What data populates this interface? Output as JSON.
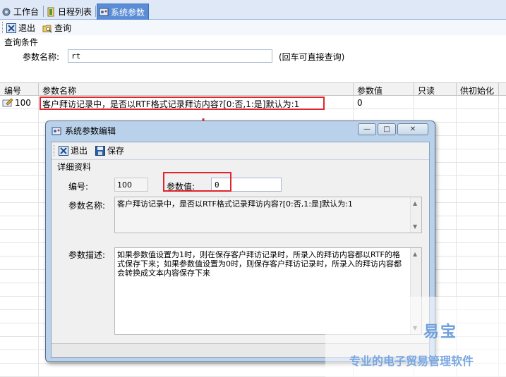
{
  "tabs": [
    {
      "label": "工作台",
      "icon": "gear-icon"
    },
    {
      "label": "日程列表",
      "icon": "schedule-icon"
    },
    {
      "label": "系统参数",
      "icon": "system-params-icon"
    }
  ],
  "toolbar": {
    "exit_label": "退出",
    "query_label": "查询"
  },
  "query": {
    "section_title": "查询条件",
    "param_name_label": "参数名称:",
    "param_name_value": "rt",
    "hint": "(回车可直接查询)"
  },
  "grid": {
    "columns": [
      "编号",
      "参数名称",
      "参数值",
      "只读",
      "供初始化"
    ],
    "rows": [
      {
        "id": "100",
        "name": "客户拜访记录中，是否以RTF格式记录拜访内容?[0:否,1:是]默认为:1",
        "value": "0"
      }
    ]
  },
  "dialog": {
    "title": "系统参数编辑",
    "toolbar": {
      "exit_label": "退出",
      "save_label": "保存"
    },
    "section_title": "详细资料",
    "id_label": "编号:",
    "id_value": "100",
    "value_label": "参数值:",
    "value_value": "0",
    "name_label": "参数名称:",
    "name_value": "客户拜访记录中，是否以RTF格式记录拜访内容?[0:否,1:是]默认为:1",
    "desc_label": "参数描述:",
    "desc_value": "如果参数值设置为1时，则在保存客户拜访记录时，所录入的拜访内容都以RTF的格式保存下来；如果参数值设置为0时，则保存客户拜访记录时，所录入的拜访内容都会转换成文本内容保存下来"
  },
  "watermark": {
    "brand": "易宝",
    "slogan": "专业的电子贸易管理软件"
  },
  "colors": {
    "highlight": "#e0262d",
    "active_tab": "#5b8dd6",
    "dialog_frame": "#b9d1ea"
  }
}
